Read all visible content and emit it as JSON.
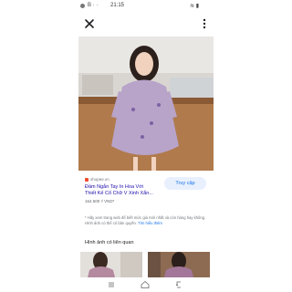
{
  "status_bar": {
    "time": "21:15",
    "indicators": "B  ·  ·",
    "signal": "≋ ▮"
  },
  "toolbar": {
    "close_icon": "close-icon",
    "more_icon": "more-vert-icon"
  },
  "result": {
    "source": "shopee.vn",
    "title_line1": "Đầm Ngắn Tay In Hoa Với",
    "title_line2": "Thiết Kế Cổ Chữ V Xinh Xắn...",
    "price": "164.500 ₫ VND*",
    "visit_label": "Truy cập"
  },
  "notice": {
    "text": "* Hãy xem trang web để biết mức giá mới nhất và còn hàng hay không. Hình ảnh có thể có bản quyền.",
    "link": "Tìm hiểu thêm"
  },
  "related": {
    "heading": "Hình ảnh có liên quan"
  },
  "colors": {
    "accent": "#1a73e8",
    "visit_bg": "#e8f0fe",
    "shop": "#ee4d2d"
  }
}
